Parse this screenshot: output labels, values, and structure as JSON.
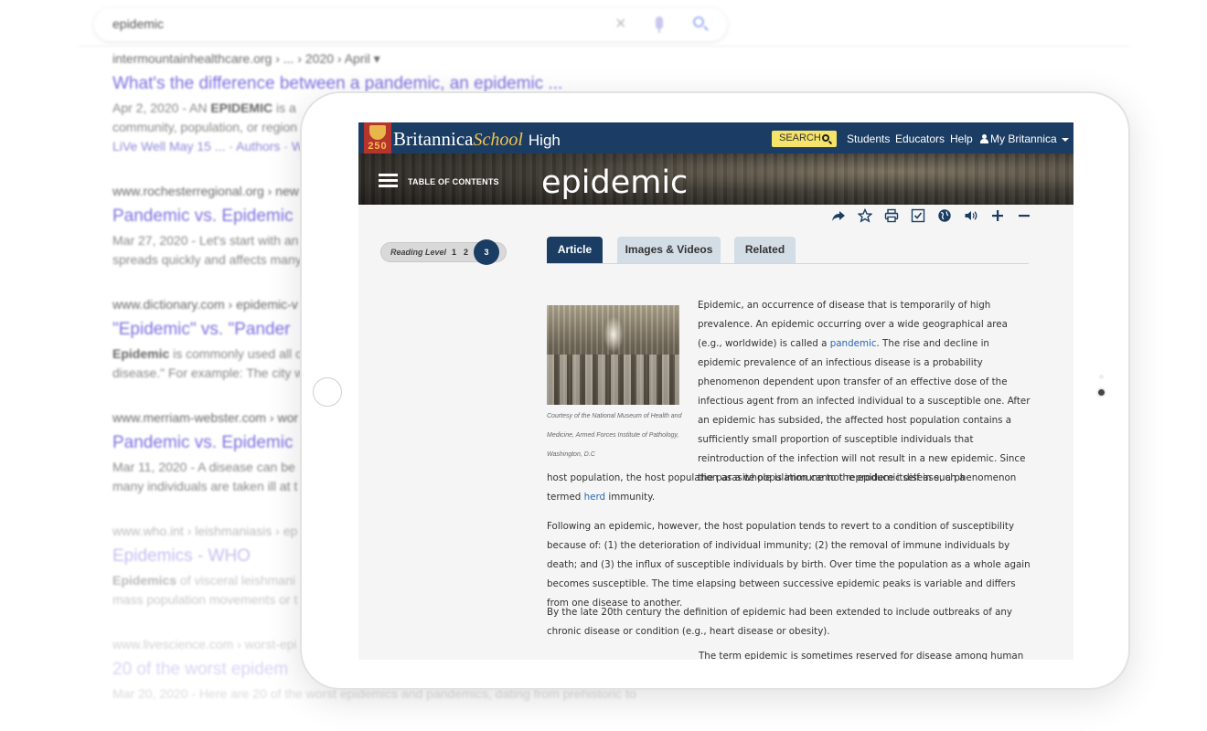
{
  "search": {
    "query": "epidemic",
    "results": [
      {
        "url": "intermountainhealthcare.org › ... › 2020 › April ▾",
        "title": "What's the difference between a pandemic, an epidemic ...",
        "snippet_line1_prefix": "Apr 2, 2020 - AN ",
        "snippet_line1_bold": "EPIDEMIC",
        "snippet_line1_suffix": " is a",
        "snippet_line2": "community, population, or region",
        "snippet_line3": "LiVe Well May 15 ... · Authors · W"
      },
      {
        "url": "www.rochesterregional.org › new",
        "title": "Pandemic vs. Epidemic",
        "snippet_line1": "Mar 27, 2020 - Let's start with an",
        "snippet_line2": "spreads quickly and affects many"
      },
      {
        "url": "www.dictionary.com › epidemic-v",
        "title": "\"Epidemic\" vs. \"Pander",
        "snippet_line1_bold": "Epidemic",
        "snippet_line1_suffix": " is commonly used all c",
        "snippet_line2": "disease.\" For example: The city w"
      },
      {
        "url": "www.merriam-webster.com › wor",
        "title": "Pandemic vs. Epidemic",
        "snippet_line1": "Mar 11, 2020 - A disease can be",
        "snippet_line2": "many individuals are taken ill at t"
      },
      {
        "url": "www.who.int › leishmaniasis › ep",
        "title": "Epidemics - WHO",
        "snippet_line1_bold": "Epidemics",
        "snippet_line1_suffix": " of visceral leishmani",
        "snippet_line2": "mass population movements or t"
      },
      {
        "url": "www.livescience.com › worst-epi",
        "title": "20 of the worst epidem",
        "snippet_line1": "Mar 20, 2020 - Here are 20 of the worst epidemics and pandemics, dating from prehistoric to"
      }
    ]
  },
  "britannica": {
    "logo_number": "250",
    "brand": "Britannica",
    "school": "School",
    "level": "High",
    "search_label": "SEARCH",
    "nav": [
      "Students",
      "Educators",
      "Help"
    ],
    "my_britannica": "My Britannica",
    "toc_label": "TABLE OF CONTENTS",
    "title": "epidemic",
    "reading_level": {
      "label": "Reading Level",
      "levels": [
        "1",
        "2",
        "3"
      ],
      "active": "3"
    },
    "tabs": [
      "Article",
      "Images & Videos",
      "Related"
    ],
    "figure_caption": "Courtesy of the National Museum of Health and Medicine, Armed Forces Institute of Pathology, Washington, D.C",
    "article": {
      "p1_before": "Epidemic, an occurrence of disease that is temporarily of high prevalence. An epidemic occurring over a wide geographical area (e.g., worldwide) is called a ",
      "p1_link": "pandemic",
      "p1_after": ". The rise and decline in epidemic prevalence of an infectious disease is a probability phenomenon dependent upon transfer of an effective dose of the infectious agent from an infected individual to a susceptible one. After an epidemic has subsided, the affected host population contains a sufficiently small proportion of susceptible individuals that reintroduction of the infection will not result in a new epidemic. Since the parasite population cannot reproduce itself in such a",
      "p1_cont": "host population, the host population as a whole is immune to the epidemic disease, a phenomenon termed",
      "p1_link2": "herd",
      "p1_end": " immunity.",
      "p2": "Following an epidemic, however, the host population tends to revert to a condition of susceptibility because of: (1) the deterioration of individual immunity; (2) the removal of immune individuals by death; and (3) the influx of susceptible individuals by birth. Over time the population as a whole again becomes susceptible. The time elapsing between successive epidemic peaks is variable and differs from one disease to another.",
      "p3": "By the late 20th century the definition of epidemic had been extended to include outbreaks of any chronic disease or condition (e.g., heart disease or obesity).",
      "p4_cut": "The term epidemic is sometimes reserved for disease among human"
    },
    "toolbar_icons": [
      "share-icon",
      "star-icon",
      "print-icon",
      "checklist-icon",
      "globe-icon",
      "audio-icon",
      "zoom-in-icon",
      "zoom-out-icon"
    ]
  }
}
